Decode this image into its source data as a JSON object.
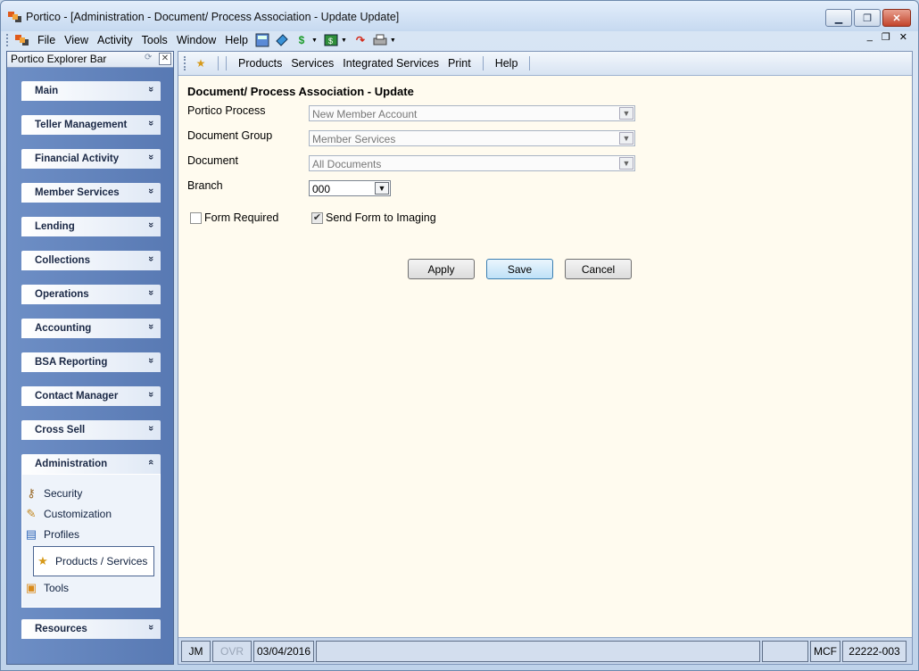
{
  "window": {
    "title": "Portico - [Administration - Document/ Process Association - Update Update]",
    "controls": {
      "minimize": "▁",
      "maximize": "❐",
      "close": "✕"
    }
  },
  "menubar": {
    "items": [
      "File",
      "View",
      "Activity",
      "Tools",
      "Window",
      "Help"
    ],
    "mdi_controls": {
      "minimize": "_",
      "restore": "❐",
      "close": "✕"
    }
  },
  "explorer": {
    "title": "Portico Explorer Bar",
    "groups": [
      {
        "label": "Main"
      },
      {
        "label": "Teller Management"
      },
      {
        "label": "Financial Activity"
      },
      {
        "label": "Member Services"
      },
      {
        "label": "Lending"
      },
      {
        "label": "Collections"
      },
      {
        "label": "Operations"
      },
      {
        "label": "Accounting"
      },
      {
        "label": "BSA Reporting"
      },
      {
        "label": "Contact Manager"
      },
      {
        "label": "Cross Sell"
      },
      {
        "label": "Administration"
      },
      {
        "label": "Resources"
      }
    ],
    "admin_tasks": [
      {
        "label": "Security",
        "icon": "security-icon"
      },
      {
        "label": "Customization",
        "icon": "customization-icon"
      },
      {
        "label": "Profiles",
        "icon": "profiles-icon"
      },
      {
        "label": "Products / Services",
        "icon": "products-services-icon",
        "selected": true
      },
      {
        "label": "Tools",
        "icon": "tools-icon"
      }
    ],
    "chevron_down": "»",
    "chevron_up": "«"
  },
  "toolbar": {
    "items": [
      "Products",
      "Services",
      "Integrated Services",
      "Print"
    ],
    "help": "Help"
  },
  "form": {
    "title": "Document/ Process Association - Update",
    "portico_process": {
      "label": "Portico Process",
      "value": "New Member Account"
    },
    "document_group": {
      "label": "Document Group",
      "value": "Member Services"
    },
    "document": {
      "label": "Document",
      "value": "All Documents"
    },
    "branch": {
      "label": "Branch",
      "value": "000"
    },
    "form_required": {
      "label": "Form Required",
      "checked": false
    },
    "send_to_imaging": {
      "label": "Send Form to Imaging",
      "checked": true
    },
    "buttons": {
      "apply": "Apply",
      "save": "Save",
      "cancel": "Cancel"
    }
  },
  "status": {
    "user": "JM",
    "ovr": "OVR",
    "date": "03/04/2016",
    "mode": "MCF",
    "code": "22222-003"
  }
}
